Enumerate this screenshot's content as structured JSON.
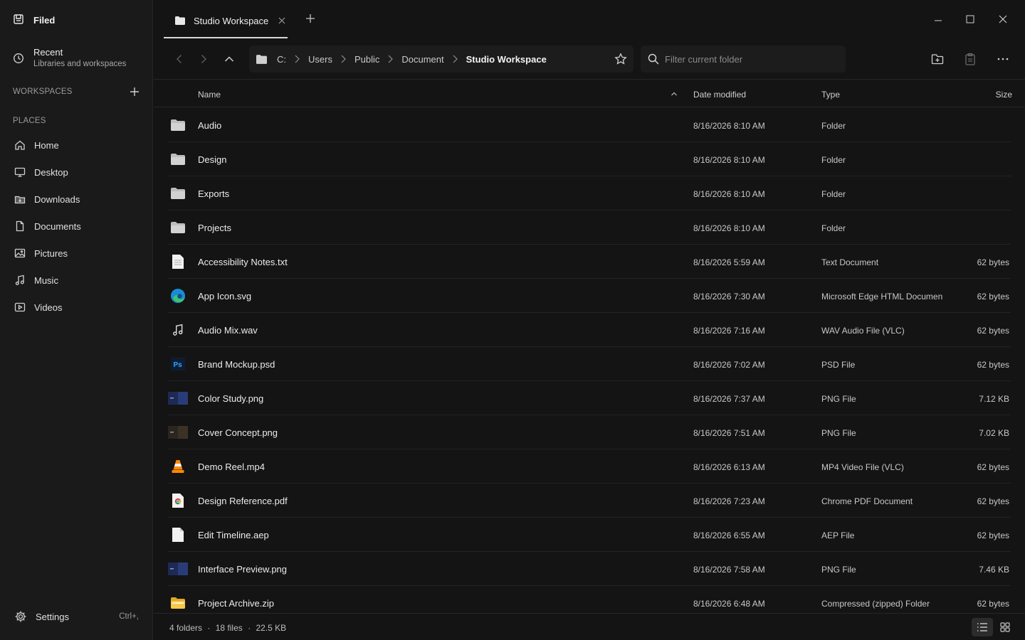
{
  "app": {
    "name": "Filed"
  },
  "sidebar": {
    "recent": {
      "title": "Recent",
      "subtitle": "Libraries and workspaces"
    },
    "workspaces_label": "WORKSPACES",
    "places_label": "PLACES",
    "places": [
      {
        "label": "Home",
        "icon": "home-icon"
      },
      {
        "label": "Desktop",
        "icon": "desktop-icon"
      },
      {
        "label": "Downloads",
        "icon": "downloads-icon"
      },
      {
        "label": "Documents",
        "icon": "documents-icon"
      },
      {
        "label": "Pictures",
        "icon": "pictures-icon"
      },
      {
        "label": "Music",
        "icon": "music-icon"
      },
      {
        "label": "Videos",
        "icon": "videos-icon"
      }
    ],
    "settings": {
      "label": "Settings",
      "shortcut": "Ctrl+,"
    }
  },
  "tabs": [
    {
      "label": "Studio Workspace",
      "active": true
    }
  ],
  "breadcrumb": [
    "C:",
    "Users",
    "Public",
    "Document",
    "Studio Workspace"
  ],
  "search": {
    "placeholder": "Filter current folder"
  },
  "columns": {
    "name": "Name",
    "date": "Date modified",
    "type": "Type",
    "size": "Size"
  },
  "files": [
    {
      "name": "Audio",
      "date": "8/16/2026  8:10 AM",
      "type": "Folder",
      "size": "",
      "icon": "folder"
    },
    {
      "name": "Design",
      "date": "8/16/2026  8:10 AM",
      "type": "Folder",
      "size": "",
      "icon": "folder"
    },
    {
      "name": "Exports",
      "date": "8/16/2026  8:10 AM",
      "type": "Folder",
      "size": "",
      "icon": "folder"
    },
    {
      "name": "Projects",
      "date": "8/16/2026  8:10 AM",
      "type": "Folder",
      "size": "",
      "icon": "folder"
    },
    {
      "name": "Accessibility Notes.txt",
      "date": "8/16/2026  5:59 AM",
      "type": "Text Document",
      "size": "62 bytes",
      "icon": "text"
    },
    {
      "name": "App Icon.svg",
      "date": "8/16/2026  7:30 AM",
      "type": "Microsoft Edge HTML Documen",
      "size": "62 bytes",
      "icon": "edge"
    },
    {
      "name": "Audio Mix.wav",
      "date": "8/16/2026  7:16 AM",
      "type": "WAV Audio File (VLC)",
      "size": "62 bytes",
      "icon": "music"
    },
    {
      "name": "Brand Mockup.psd",
      "date": "8/16/2026  7:02 AM",
      "type": "PSD File",
      "size": "62 bytes",
      "icon": "psd"
    },
    {
      "name": "Color Study.png",
      "date": "8/16/2026  7:37 AM",
      "type": "PNG File",
      "size": "7.12 KB",
      "icon": "image-blue"
    },
    {
      "name": "Cover Concept.png",
      "date": "8/16/2026  7:51 AM",
      "type": "PNG File",
      "size": "7.02 KB",
      "icon": "image-brown"
    },
    {
      "name": "Demo Reel.mp4",
      "date": "8/16/2026  6:13 AM",
      "type": "MP4 Video File (VLC)",
      "size": "62 bytes",
      "icon": "vlc"
    },
    {
      "name": "Design Reference.pdf",
      "date": "8/16/2026  7:23 AM",
      "type": "Chrome PDF Document",
      "size": "62 bytes",
      "icon": "chrome"
    },
    {
      "name": "Edit Timeline.aep",
      "date": "8/16/2026  6:55 AM",
      "type": "AEP File",
      "size": "62 bytes",
      "icon": "blank"
    },
    {
      "name": "Interface Preview.png",
      "date": "8/16/2026  7:58 AM",
      "type": "PNG File",
      "size": "7.46 KB",
      "icon": "image-blue"
    },
    {
      "name": "Project Archive.zip",
      "date": "8/16/2026  6:48 AM",
      "type": "Compressed (zipped) Folder",
      "size": "62 bytes",
      "icon": "zip"
    }
  ],
  "status": {
    "folders": "4 folders",
    "files": "18 files",
    "size": "22.5 KB",
    "separator": "·"
  }
}
